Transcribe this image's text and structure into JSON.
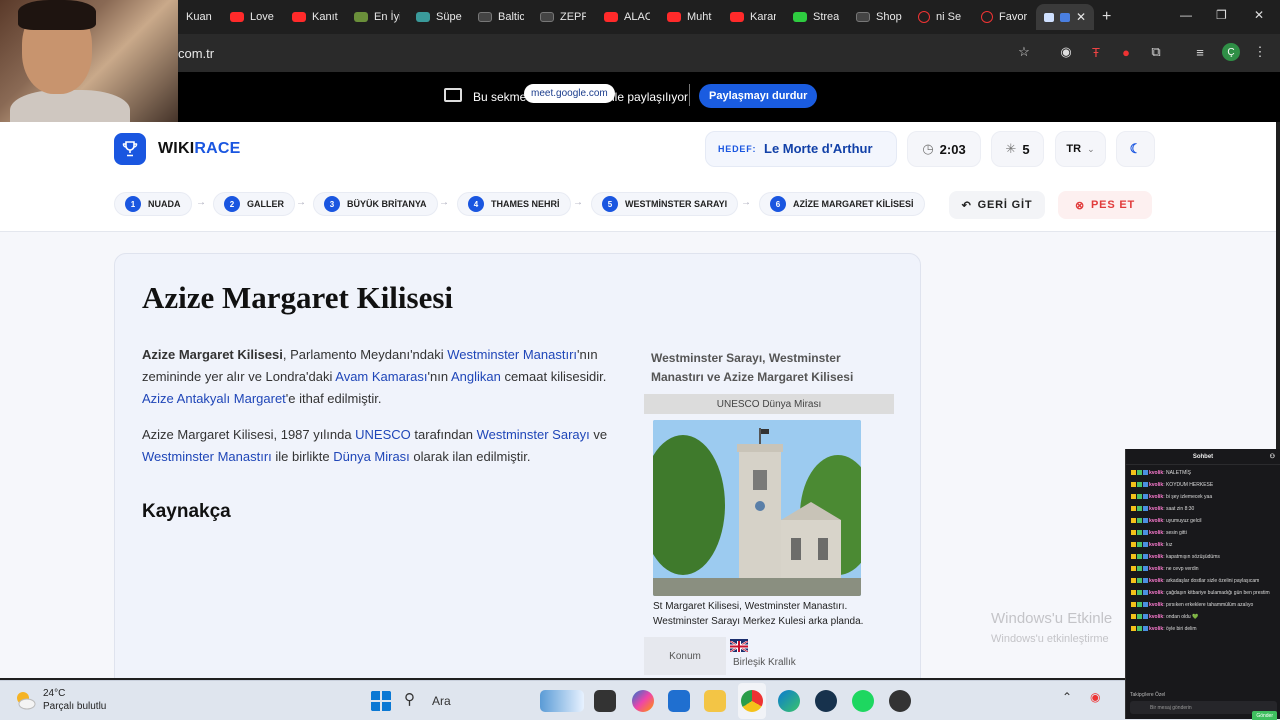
{
  "browser": {
    "tabs": [
      "Kuan",
      "Love",
      "Kanıt",
      "En İyi",
      "Süpe",
      "Baltic",
      "ZEPP",
      "ALAC",
      "Muht",
      "Karar",
      "Strea",
      "Shop",
      "ni Se",
      "Favor"
    ],
    "url": "com.tr",
    "new_tab": "+",
    "profile_initial": "Ç"
  },
  "sharebar": {
    "text_before": "Bu sekme",
    "site": "meet.google.com",
    "text_after": "ile paylaşılıyor",
    "stop_button": "Paylaşmayı durdur"
  },
  "app": {
    "logo_main": "WIKI",
    "logo_accent": "RACE",
    "target_label": "HEDEF:",
    "target_value": "Le Morte d'Arthur",
    "timer": "2:03",
    "clicks": "5",
    "language": "TR",
    "back_button": "GERİ GİT",
    "give_up_button": "PES ET",
    "accent_color": "#1a56e0"
  },
  "breadcrumbs": [
    {
      "n": "1",
      "label": "NUADA"
    },
    {
      "n": "2",
      "label": "GALLER"
    },
    {
      "n": "3",
      "label": "BÜYÜK BRİTANYA"
    },
    {
      "n": "4",
      "label": "THAMES NEHRİ"
    },
    {
      "n": "5",
      "label": "WESTMİNSTER SARAYI"
    },
    {
      "n": "6",
      "label": "AZİZE MARGARET KİLİSESİ"
    }
  ],
  "article": {
    "title": "Azize Margaret Kilisesi",
    "p1": {
      "bold": "Azize Margaret Kilisesi",
      "t1": ", Parlamento Meydanı'ndaki ",
      "l1": "Westminster Manastırı",
      "t2": "'nın zemininde yer alır ve Londra'daki ",
      "l2": "Avam Kamarası",
      "t3": "'nın ",
      "l3": "Anglikan",
      "t4": " cemaat kilisesidir. ",
      "l4": "Azize Antakyalı Margaret",
      "t5": "'e ithaf edilmiştir."
    },
    "p2": {
      "t1": "Azize Margaret Kilisesi, 1987 yılında ",
      "l1": "UNESCO",
      "t2": " tarafından ",
      "l2": "Westminster Sarayı",
      "t3": " ve ",
      "l3": "Westminster Manastırı",
      "t4": " ile birlikte ",
      "l4": "Dünya Mirası",
      "t5": " olarak ilan edilmiştir."
    },
    "section": "Kaynakça"
  },
  "infobox": {
    "caption": "Westminster Sarayı, Westminster Manastırı ve Azize Margaret Kilisesi",
    "band": "UNESCO Dünya Mirası",
    "image_caption": "St Margaret Kilisesi, Westminster Manastırı. Westminster Sarayı Merkez Kulesi arka planda.",
    "row_key": "Konum",
    "row_value": "Birleşik Krallık"
  },
  "watermark": {
    "line1": "Windows'u Etkinle",
    "line2": "Windows'u etkinleştirme"
  },
  "chat": {
    "title": "Sohbet",
    "messages": [
      {
        "user": "kvolik",
        "text": "NALETMİŞ"
      },
      {
        "user": "kvolik",
        "text": "KOYDUM HERKESE"
      },
      {
        "user": "kvolik",
        "text": "bi şey izlemecek yaa"
      },
      {
        "user": "kvolik",
        "text": "saat zin 8:30"
      },
      {
        "user": "kvolik",
        "text": "uyumuyuz gelcil"
      },
      {
        "user": "kvolik",
        "text": "sesin gitti"
      },
      {
        "user": "kvolik",
        "text": "kız"
      },
      {
        "user": "kvolik",
        "text": "kapatmışın sözüşüdüms"
      },
      {
        "user": "kvolik",
        "text": "ne cevp verdin"
      },
      {
        "user": "kvolik",
        "text": "arkadaşlar dostlar sizle özelini paylaşıcam"
      },
      {
        "user": "kvolik",
        "text": "çağdaşın kitbariye bulamadığı gün ben prestim"
      },
      {
        "user": "kvolik",
        "text": "pırsıken erkeklere tahammülüm azalıyo"
      },
      {
        "user": "kvolik",
        "text": "ondan oldu 💚"
      },
      {
        "user": "kvolik",
        "text": "öyle biri delim"
      }
    ],
    "footer_label": "Takipçilere Özel",
    "input_placeholder": "Bir mesaj gönderin",
    "send_button": "Gönder"
  },
  "taskbar": {
    "temperature": "24°C",
    "weather": "Parçalı bulutlu",
    "search": "Ara"
  }
}
